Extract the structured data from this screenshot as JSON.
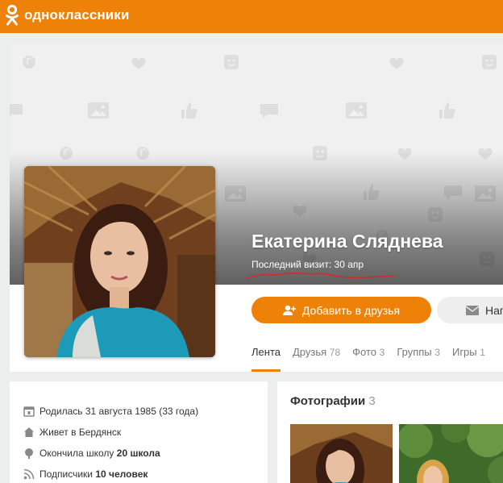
{
  "header": {
    "site_name": "одноклассники",
    "brand_color": "#ee8208"
  },
  "profile": {
    "name": "Екатерина Сляднева",
    "last_visit": "Последний визит: 30 апр",
    "add_friend_label": "Добавить в друзья",
    "message_label": "Нап"
  },
  "tabs": [
    {
      "label": "Лента",
      "count": ""
    },
    {
      "label": "Друзья",
      "count": "78"
    },
    {
      "label": "Фото",
      "count": "3"
    },
    {
      "label": "Группы",
      "count": "3"
    },
    {
      "label": "Игры",
      "count": "1"
    }
  ],
  "info": {
    "born_prefix": "Родилась 31 августа 1985 (33 года)",
    "lives": "Живет в Бердянск",
    "school_prefix": "Окончила школу",
    "school_value": "20 школа",
    "followers_prefix": "Подписчики",
    "followers_value": "10 человек"
  },
  "photos": {
    "title": "Фотографии",
    "count": "3"
  },
  "icons": {
    "logo": "ok-logo-icon",
    "add_friend": "add-user-icon",
    "message": "envelope-icon",
    "born": "calendar-icon",
    "lives": "home-icon",
    "school": "graduation-icon",
    "followers": "rss-icon"
  }
}
